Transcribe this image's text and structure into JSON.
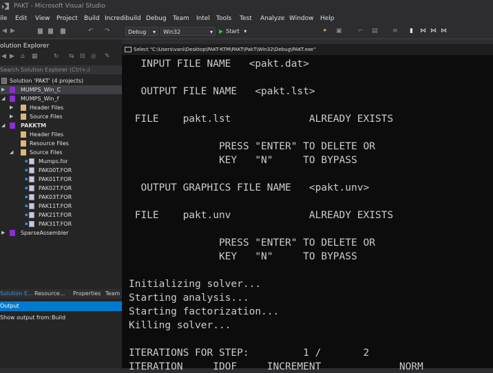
{
  "window": {
    "title": "PAKT - Microsoft Visual Studio"
  },
  "menu": [
    "ile",
    "Edit",
    "View",
    "Project",
    "Build",
    "Incredibuild",
    "Debug",
    "Team",
    "Intel",
    "Tools",
    "Test",
    "Analyze",
    "Window",
    "Help"
  ],
  "toolbar": {
    "config": "Debug",
    "platform": "Win32",
    "start": "Start"
  },
  "solution_explorer": {
    "title": "olution Explorer",
    "search_placeholder": "Search Solution Explorer (Ctrl+;)",
    "items": [
      {
        "label": "Solution 'PAKT' (4 projects)",
        "type": "solution"
      },
      {
        "label": "MUMPS_Win_C",
        "type": "project",
        "selected": true
      },
      {
        "label": "MUMPS_Win_f",
        "type": "project"
      },
      {
        "label": "Header Files",
        "type": "folder"
      },
      {
        "label": "Source Files",
        "type": "folder"
      },
      {
        "label": "PAKKTM",
        "type": "project",
        "bold": true
      },
      {
        "label": "Header Files",
        "type": "folder"
      },
      {
        "label": "Resource Files",
        "type": "folder"
      },
      {
        "label": "Source Files",
        "type": "folder"
      },
      {
        "label": "Mumps.for",
        "type": "file"
      },
      {
        "label": "PAK00T.FOR",
        "type": "file"
      },
      {
        "label": "PAK01T.FOR",
        "type": "file"
      },
      {
        "label": "PAK02T.FOR",
        "type": "file"
      },
      {
        "label": "PAK03T.FOR",
        "type": "file"
      },
      {
        "label": "PAK11T.FOR",
        "type": "file"
      },
      {
        "label": "PAK21T.FOR",
        "type": "file"
      },
      {
        "label": "PAK31T.FOR",
        "type": "file"
      },
      {
        "label": "SparseAssembler",
        "type": "project"
      }
    ],
    "tabs": [
      "Solution E...",
      "Resource...",
      "Properties",
      "Team"
    ]
  },
  "output": {
    "title": "Output",
    "show_from_label": "Show output from:",
    "show_from_value": "Build"
  },
  "console": {
    "title": "Select \"C:\\Users\\vani\\Desktop\\PAKT-KTM\\PAKT\\PakT\\Win32\\Debug\\PAKT.exe\"",
    "lines": [
      "  INPUT FILE NAME   <pakt.dat>",
      "",
      "  OUTPUT FILE NAME   <pakt.lst>",
      "",
      " FILE    pakt.lst             ALREADY EXISTS",
      "",
      "               PRESS \"ENTER\" TO DELETE OR",
      "               KEY   \"N\"     TO BYPASS",
      "",
      "  OUTPUT GRAPHICS FILE NAME   <pakt.unv>",
      "",
      " FILE    pakt.unv             ALREADY EXISTS",
      "",
      "               PRESS \"ENTER\" TO DELETE OR",
      "               KEY   \"N\"     TO BYPASS",
      "",
      "Initializing solver...",
      "Starting analysis...",
      "Starting factorization...",
      "Killing solver...",
      "",
      "ITERATIONS FOR STEP:         1 /       2",
      "ITERATION     IDOF     INCREMENT             NORM"
    ]
  }
}
